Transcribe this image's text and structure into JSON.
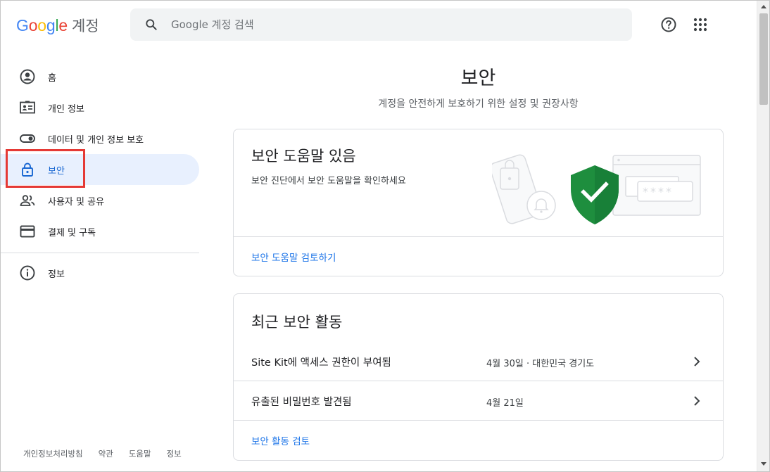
{
  "header": {
    "logo_google": [
      "G",
      "o",
      "o",
      "g",
      "l",
      "e"
    ],
    "logo_product": "계정",
    "search_placeholder": "Google 계정 검색",
    "icons": {
      "search": "search-icon",
      "help": "help-circle-icon",
      "apps": "apps-grid-icon"
    }
  },
  "sidebar": {
    "items": [
      {
        "label": "홈",
        "icon": "account-circle-icon"
      },
      {
        "label": "개인 정보",
        "icon": "id-card-icon"
      },
      {
        "label": "데이터 및 개인 정보 보호",
        "icon": "toggle-icon"
      },
      {
        "label": "보안",
        "icon": "lock-icon",
        "active": true
      },
      {
        "label": "사용자 및 공유",
        "icon": "people-icon"
      },
      {
        "label": "결제 및 구독",
        "icon": "credit-card-icon"
      }
    ],
    "info_item": {
      "label": "정보",
      "icon": "info-icon"
    },
    "footer": [
      "개인정보처리방침",
      "약관",
      "도움말",
      "정보"
    ]
  },
  "main": {
    "title": "보안",
    "subtitle": "계정을 안전하게 보호하기 위한 설정 및 권장사항",
    "tips_card": {
      "title": "보안 도움말 있음",
      "description": "보안 진단에서 보안 도움말을 확인하세요",
      "link": "보안 도움말 검토하기",
      "password_mask": "****"
    },
    "activity_card": {
      "title": "최근 보안 활동",
      "rows": [
        {
          "title": "Site Kit에 액세스 권한이 부여됨",
          "meta": "4월 30일 · 대한민국 경기도"
        },
        {
          "title": "유출된 비밀번호 발견됨",
          "meta": "4월 21일"
        }
      ],
      "link": "보안 활동 검토"
    }
  },
  "colors": {
    "accent": "#1a73e8",
    "active_bg": "#e8f0fe",
    "shield": "#1e8e3e",
    "highlight": "#e53935"
  }
}
